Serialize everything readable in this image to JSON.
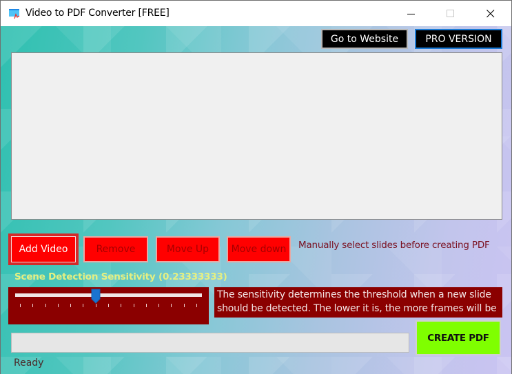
{
  "window": {
    "title": "Video to PDF Converter [FREE]",
    "icon": "video-pdf-app-icon",
    "controls": {
      "minimize": "minimize-icon",
      "maximize": "maximize-icon",
      "close": "close-icon"
    }
  },
  "header": {
    "website_button": "Go to Website",
    "pro_button": "PRO VERSION"
  },
  "video_list": {
    "items": []
  },
  "actions": {
    "add_video": "Add Video",
    "remove": "Remove",
    "move_up": "Move Up",
    "move_down": "Move down",
    "hint": "Manually select slides before creating PDF"
  },
  "sensitivity": {
    "label": "Scene Detection Sensitivity (0.23333333)",
    "value": 0.23333333,
    "slider_fraction": 0.4286,
    "tick_count": 15,
    "description": "The sensitivity determines the threshold when a new slide should be detected. The lower it is, the more frames will be"
  },
  "footer": {
    "progress_percent": 0,
    "create_button": "CREATE PDF",
    "status": "Ready"
  },
  "colors": {
    "red_button": "#ff0000",
    "dark_red_panel": "#8b0000",
    "create_green": "#7fff00",
    "label_yellow": "#e6f080",
    "hint_text": "#7a1020",
    "pro_border": "#1c7bd6",
    "slider_thumb": "#1a73d0"
  }
}
